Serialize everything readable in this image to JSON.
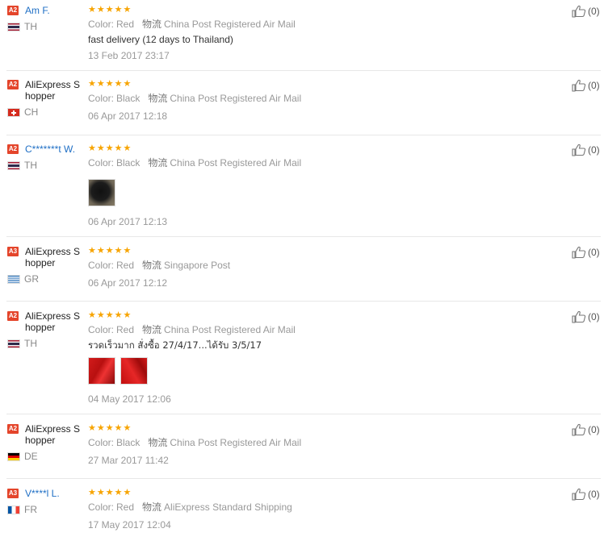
{
  "labels": {
    "color": "Color:",
    "shipping": "物流"
  },
  "reviews": [
    {
      "level": "A2",
      "name": "Am F.",
      "country": "TH",
      "rating": 5,
      "color": "Red",
      "shipping": "China Post Registered Air Mail",
      "text": "fast delivery (12 days to Thailand)",
      "date": "13 Feb 2017 23:17",
      "helpful": "(0)"
    },
    {
      "level": "A2",
      "name": "AliExpress Shopper",
      "country": "CH",
      "rating": 5,
      "color": "Black",
      "shipping": "China Post Registered Air Mail",
      "text": "",
      "date": "06 Apr 2017 12:18",
      "helpful": "(0)"
    },
    {
      "level": "A2",
      "name": "C*******t W.",
      "country": "TH",
      "rating": 5,
      "color": "Black",
      "shipping": "China Post Registered Air Mail",
      "text": "",
      "photos": [
        "black-shirt-photo"
      ],
      "date": "06 Apr 2017 12:13",
      "helpful": "(0)"
    },
    {
      "level": "A3",
      "name": "AliExpress Shopper",
      "country": "GR",
      "rating": 5,
      "color": "Red",
      "shipping": "Singapore Post",
      "text": "",
      "date": "06 Apr 2017 12:12",
      "helpful": "(0)"
    },
    {
      "level": "A2",
      "name": "AliExpress Shopper",
      "country": "TH",
      "rating": 5,
      "color": "Red",
      "shipping": "China Post Registered Air Mail",
      "text": "รวดเร็วมาก สั่งซื้อ 27/4/17...ได้รับ 3/5/17",
      "photos": [
        "red-shirt-photo",
        "red-shirt-photo"
      ],
      "date": "04 May 2017 12:06",
      "helpful": "(0)"
    },
    {
      "level": "A2",
      "name": "AliExpress Shopper",
      "country": "DE",
      "rating": 5,
      "color": "Black",
      "shipping": "China Post Registered Air Mail",
      "text": "",
      "date": "27 Mar 2017 11:42",
      "helpful": "(0)"
    },
    {
      "level": "A3",
      "name": "V****l L.",
      "country": "FR",
      "rating": 5,
      "color": "Red",
      "shipping": "AliExpress Standard Shipping",
      "text": "",
      "date": "17 May 2017 12:04",
      "helpful": "(0)"
    }
  ]
}
